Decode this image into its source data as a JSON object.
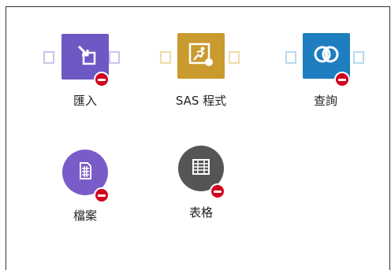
{
  "nodes": [
    {
      "label": "匯入",
      "icon": "import-icon",
      "color": "#6e58c3",
      "port_color": "#c9c3ea",
      "shape": "square",
      "status": "error"
    },
    {
      "label": "SAS 程式",
      "icon": "sas-program-icon",
      "color": "#c99a2e",
      "port_color": "#f0dca9",
      "shape": "square",
      "status": "error"
    },
    {
      "label": "查詢",
      "icon": "query-icon",
      "color": "#1f7ec0",
      "port_color": "#b8d9f0",
      "shape": "square",
      "status": "error"
    },
    {
      "label": "檔案",
      "icon": "file-icon",
      "color": "#7a5cc8",
      "shape": "circle",
      "status": "error"
    },
    {
      "label": "表格",
      "icon": "table-icon",
      "color": "#555555",
      "shape": "circle",
      "status": "error"
    }
  ],
  "colors": {
    "error_badge": "#d1001f",
    "border": "#333333"
  }
}
